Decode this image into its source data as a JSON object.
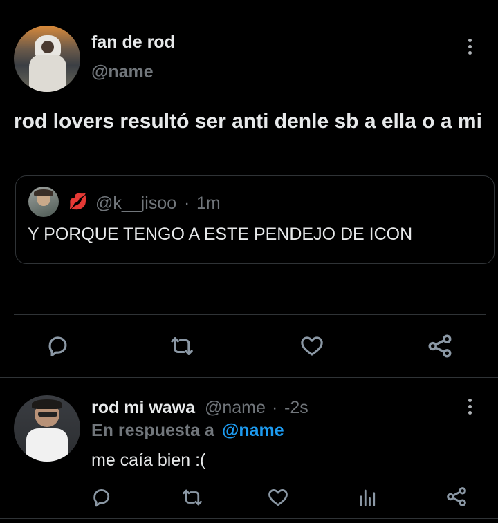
{
  "main_tweet": {
    "display_name": "fan de rod",
    "handle": "@name",
    "text": "rod lovers resultó ser anti denle sb a ella o a mi",
    "quoted": {
      "emoji": "💋",
      "handle": "@k__jisoo",
      "separator": "·",
      "time": "1m",
      "text": "Y PORQUE TENGO A ESTE PENDEJO DE ICON"
    },
    "actions": [
      "reply-icon",
      "retweet-icon",
      "like-icon",
      "share-icon"
    ]
  },
  "reply_tweet": {
    "display_name": "rod mi wawa",
    "handle": "@name",
    "separator": "·",
    "time": "-2s",
    "replying_prefix": "En respuesta a",
    "replying_handle": "@name",
    "text": "me caía bien :(",
    "actions": [
      "reply-icon",
      "retweet-icon",
      "like-icon",
      "analytics-icon",
      "share-icon"
    ]
  },
  "colors": {
    "background": "#000000",
    "text": "#e7e9ea",
    "muted": "#71767b",
    "link": "#1d9bf0",
    "divider": "#2f3336"
  }
}
